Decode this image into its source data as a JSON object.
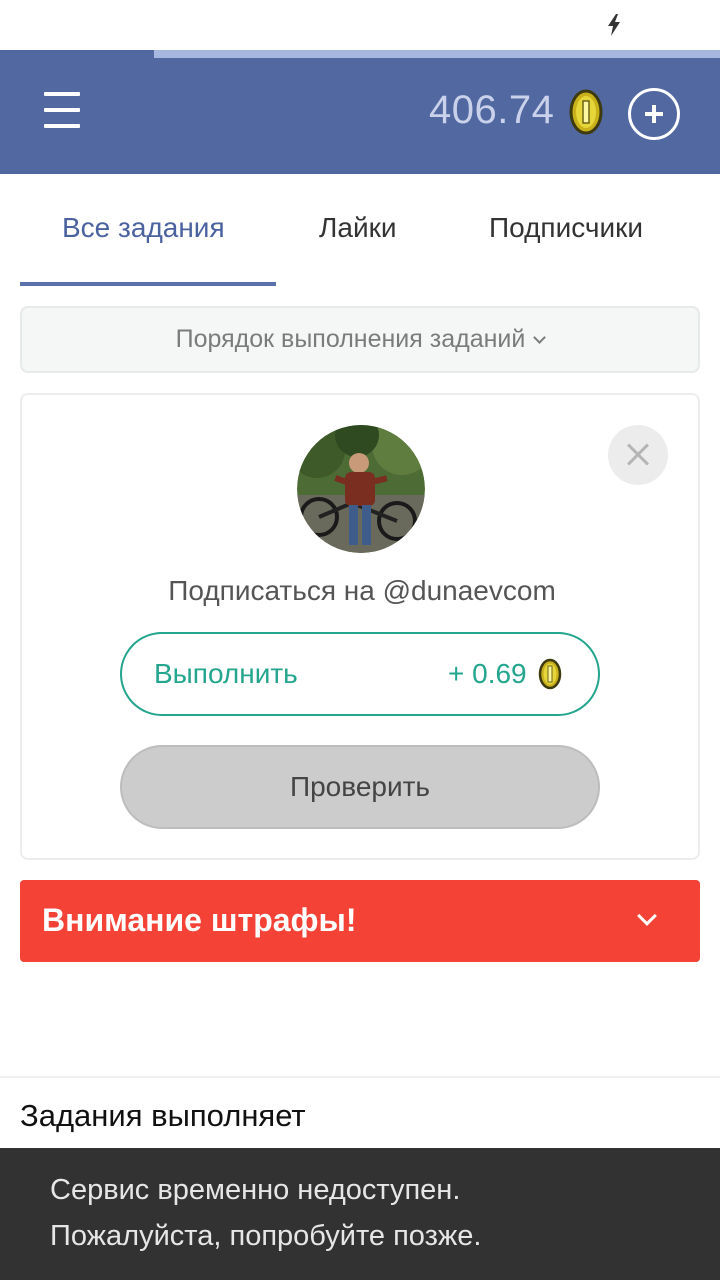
{
  "header": {
    "balance": "406.74",
    "coin_icon": "coin-icon",
    "menu_icon": "menu-icon",
    "add_icon": "plus-circle-icon",
    "bg_color": "#5168a0"
  },
  "tabs": [
    {
      "label": "Все задания",
      "active": true
    },
    {
      "label": "Лайки",
      "active": false
    },
    {
      "label": "Подписчики",
      "active": false
    }
  ],
  "order_select": {
    "label": "Порядок выполнения заданий"
  },
  "task": {
    "text": "Подписаться на @dunaevcom",
    "do_label": "Выполнить",
    "reward": "+ 0.69",
    "check_label": "Проверить"
  },
  "warning": {
    "text": "Внимание штрафы!",
    "color": "#f44236"
  },
  "section": {
    "title": "Задания выполняет"
  },
  "toast": {
    "line1": "Сервис временно недоступен.",
    "line2": "Пожалуйста, попробуйте позже."
  },
  "colors": {
    "accent": "#4b62a0",
    "success": "#23a58e"
  }
}
